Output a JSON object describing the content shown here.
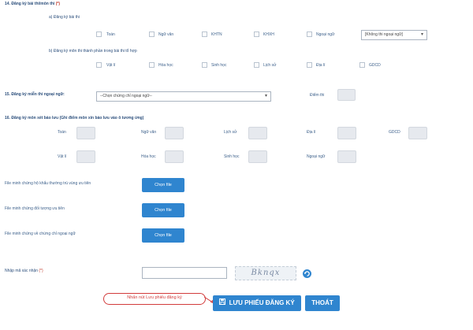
{
  "section14": {
    "title": "14. Đăng ký bài thi/môn thi",
    "required_mark": "(*)",
    "a": {
      "title": "a) Đăng ký bài thi",
      "items": [
        "Toán",
        "Ngữ văn",
        "KHTN",
        "KHXH",
        "Ngoại ngữ"
      ],
      "select_value": "[Không thi ngoại ngữ]"
    },
    "b": {
      "title": "b) Đăng ký môn thi thành phần trong bài thi tổ hợp",
      "items": [
        "Vật lí",
        "Hóa học",
        "Sinh học",
        "Lịch sử",
        "Địa lí",
        "GDCD"
      ]
    }
  },
  "section15": {
    "title": "15. Đăng ký miễn thi ngoại ngữ:",
    "select_value": "--Chọn chứng chỉ ngoại ngữ--",
    "score_label": "Điểm thi"
  },
  "section16": {
    "title": "16. Đăng ký môn xét bảo lưu (Ghi điểm môn xin bảo lưu vào ô tương ứng)",
    "row1": [
      "Toán",
      "Ngữ văn",
      "Lịch sử",
      "Địa lí",
      "GDCD"
    ],
    "row2": [
      "Vật lí",
      "Hóa học",
      "Sinh học",
      "Ngoại ngữ"
    ]
  },
  "files": [
    {
      "label": "File minh chứng hộ khẩu thường trú vùng ưu tiên",
      "button": "Chọn file"
    },
    {
      "label": "File minh chứng đối tượng ưu tiên",
      "button": "Chọn file"
    },
    {
      "label": "File minh chứng về chứng chỉ ngoại ngữ",
      "button": "Chọn file"
    }
  ],
  "captcha": {
    "label": "Nhập mã xác nhận",
    "required_mark": "(*)",
    "text": "Bknqx",
    "refresh_icon": "refresh-icon"
  },
  "actions": {
    "tooltip": "Nhấn nút Lưu phiếu đăng ký",
    "save_label": "LƯU PHIẾU ĐĂNG KÝ",
    "save_icon": "save-icon",
    "exit_label": "THOÁT"
  },
  "colors": {
    "primary": "#2f85cf",
    "text": "#2c4f7c",
    "required": "#c0392b",
    "tooltip_border": "#d23b3b"
  }
}
